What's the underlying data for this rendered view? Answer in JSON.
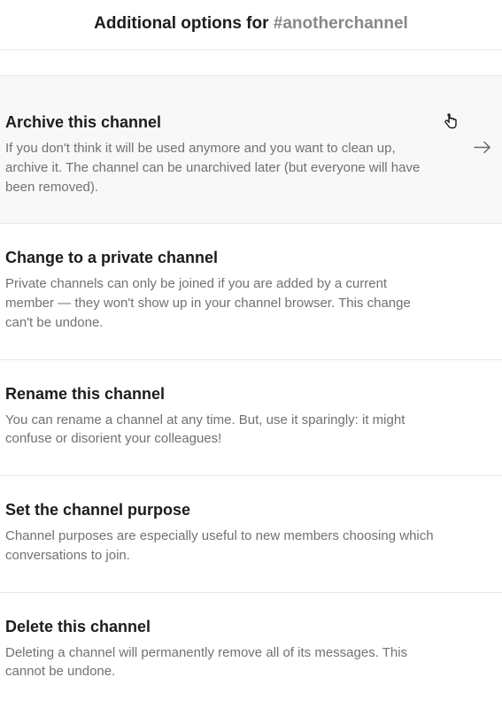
{
  "header": {
    "title_prefix": "Additional options for ",
    "channel_name": "#anotherchannel"
  },
  "options": [
    {
      "title": "Archive this channel",
      "description": "If you don't think it will be used anymore and you want to clean up, archive it. The channel can be unarchived later (but everyone will have been removed)."
    },
    {
      "title": "Change to a private channel",
      "description": "Private channels can only be joined if you are added by a current member — they won't show up in your channel browser. This change can't be undone."
    },
    {
      "title": "Rename this channel",
      "description": "You can rename a channel at any time. But, use it sparingly: it might confuse or disorient your colleagues!"
    },
    {
      "title": "Set the channel purpose",
      "description": "Channel purposes are especially useful to new members choosing which conversations to join."
    },
    {
      "title": "Delete this channel",
      "description": "Deleting a channel will permanently remove all of its messages. This cannot be undone."
    }
  ]
}
